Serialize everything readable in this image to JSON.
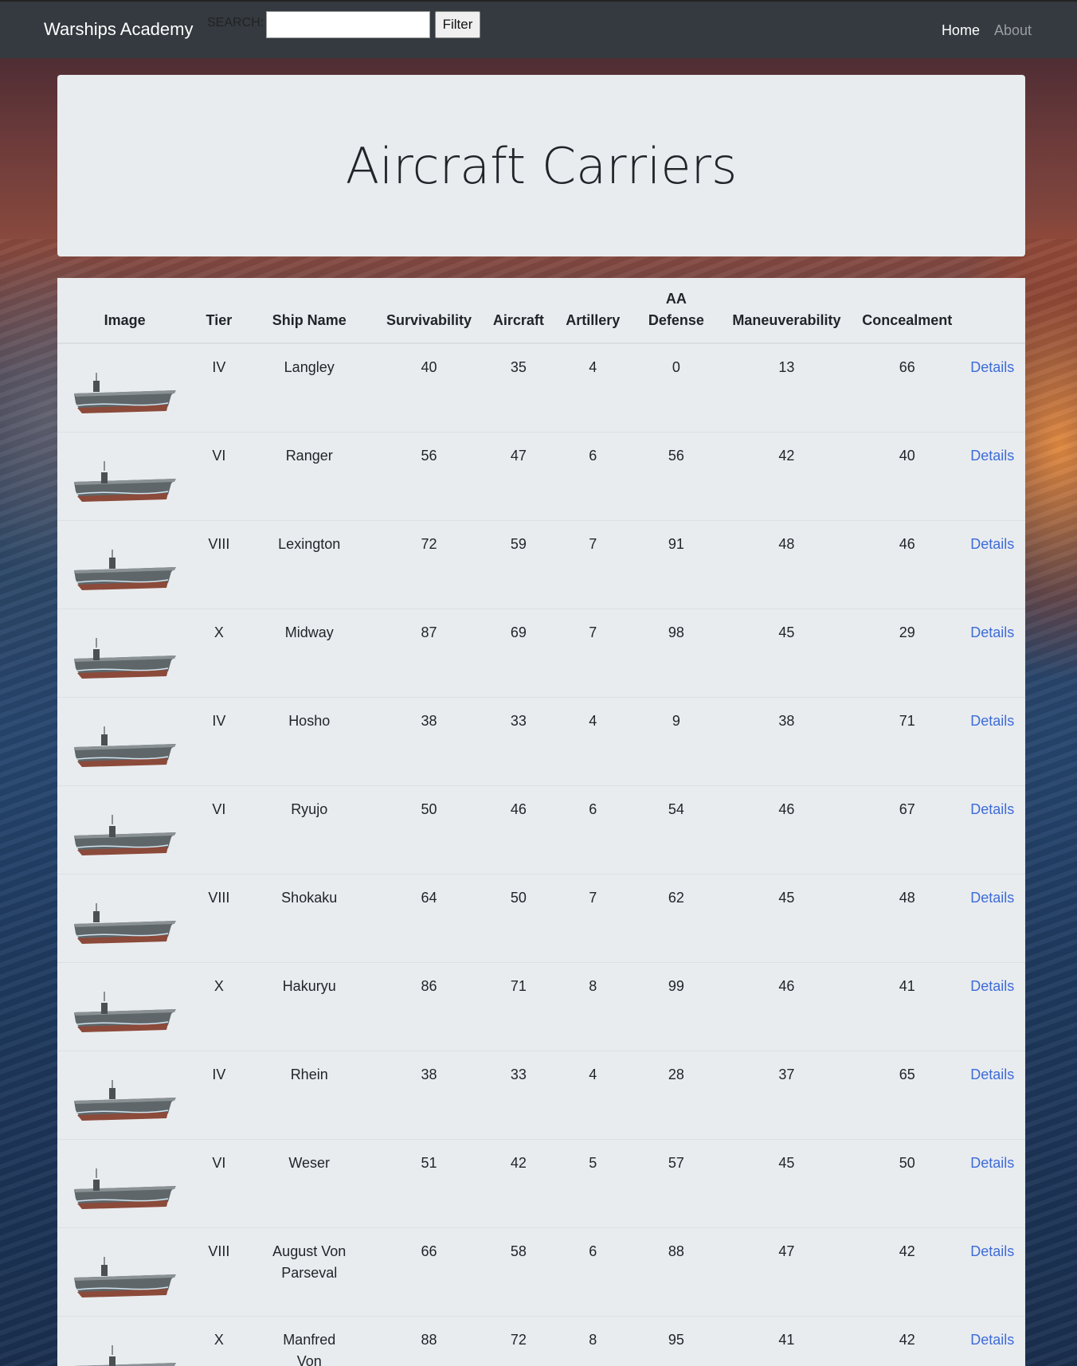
{
  "navbar": {
    "brand": "Warships Academy",
    "search_label": "SEARCH:",
    "search_value": "",
    "filter_label": "Filter",
    "links": [
      "Home",
      "About"
    ]
  },
  "jumbotron": {
    "title": "Aircraft Carriers"
  },
  "table": {
    "headers": {
      "image": "Image",
      "tier": "Tier",
      "ship_name": "Ship Name",
      "survivability": "Survivability",
      "aircraft": "Aircraft",
      "artillery": "Artillery",
      "aa_defense": "AA Defense",
      "maneuverability": "Maneuverability",
      "concealment": "Concealment"
    },
    "details_label": "Details",
    "rows": [
      {
        "tier": "IV",
        "name": "Langley",
        "survivability": "40",
        "aircraft": "35",
        "artillery": "4",
        "aa": "0",
        "maneuverability": "13",
        "concealment": "66"
      },
      {
        "tier": "VI",
        "name": "Ranger",
        "survivability": "56",
        "aircraft": "47",
        "artillery": "6",
        "aa": "56",
        "maneuverability": "42",
        "concealment": "40"
      },
      {
        "tier": "VIII",
        "name": "Lexington",
        "survivability": "72",
        "aircraft": "59",
        "artillery": "7",
        "aa": "91",
        "maneuverability": "48",
        "concealment": "46"
      },
      {
        "tier": "X",
        "name": "Midway",
        "survivability": "87",
        "aircraft": "69",
        "artillery": "7",
        "aa": "98",
        "maneuverability": "45",
        "concealment": "29"
      },
      {
        "tier": "IV",
        "name": "Hosho",
        "survivability": "38",
        "aircraft": "33",
        "artillery": "4",
        "aa": "9",
        "maneuverability": "38",
        "concealment": "71"
      },
      {
        "tier": "VI",
        "name": "Ryujo",
        "survivability": "50",
        "aircraft": "46",
        "artillery": "6",
        "aa": "54",
        "maneuverability": "46",
        "concealment": "67"
      },
      {
        "tier": "VIII",
        "name": "Shokaku",
        "survivability": "64",
        "aircraft": "50",
        "artillery": "7",
        "aa": "62",
        "maneuverability": "45",
        "concealment": "48"
      },
      {
        "tier": "X",
        "name": "Hakuryu",
        "survivability": "86",
        "aircraft": "71",
        "artillery": "8",
        "aa": "99",
        "maneuverability": "46",
        "concealment": "41"
      },
      {
        "tier": "IV",
        "name": "Rhein",
        "survivability": "38",
        "aircraft": "33",
        "artillery": "4",
        "aa": "28",
        "maneuverability": "37",
        "concealment": "65"
      },
      {
        "tier": "VI",
        "name": "Weser",
        "survivability": "51",
        "aircraft": "42",
        "artillery": "5",
        "aa": "57",
        "maneuverability": "45",
        "concealment": "50"
      },
      {
        "tier": "VIII",
        "name": "August Von Parseval",
        "survivability": "66",
        "aircraft": "58",
        "artillery": "6",
        "aa": "88",
        "maneuverability": "47",
        "concealment": "42"
      },
      {
        "tier": "X",
        "name": "Manfred Von Richtofen",
        "survivability": "88",
        "aircraft": "72",
        "artillery": "8",
        "aa": "95",
        "maneuverability": "41",
        "concealment": "42"
      }
    ]
  }
}
